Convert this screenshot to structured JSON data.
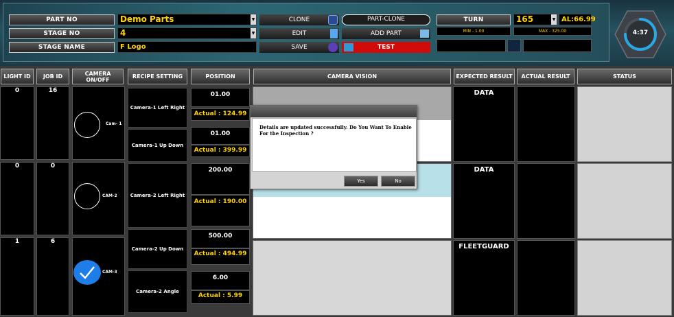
{
  "header": {
    "labels": {
      "part_no": "PART NO",
      "stage_no": "STAGE NO",
      "stage_name": "STAGE NAME"
    },
    "fields": {
      "part_no": "Demo Parts",
      "stage_no": "4",
      "stage_name": "F Logo"
    },
    "buttons": {
      "clone": "CLONE",
      "part_clone": "PART-CLONE",
      "edit": "EDIT",
      "add_part": "ADD PART",
      "save": "SAVE",
      "test": "TEST",
      "turn": "TURN"
    },
    "turn_value": "165",
    "al_value": "AL:66.99",
    "min_label": "MIN - 1.00",
    "max_label": "MAX - 325.00",
    "timer": "4:37",
    "timer_progress": 0.75
  },
  "columns": {
    "light_id": "LIGHT ID",
    "job_id": "JOB ID",
    "camera_on_off": "CAMERA ON/OFF",
    "recipe_setting": "RECIPE SETTING",
    "position": "POSITION",
    "camera_vision": "CAMERA VISION",
    "expected_result": "EXPECTED RESULT",
    "actual_result": "ACTUAL RESULT",
    "status": "STATUS"
  },
  "rows": [
    {
      "light_id": "0",
      "job_id": "16",
      "camera": "Cam- 1",
      "camera_on": false,
      "expected": "DATA"
    },
    {
      "light_id": "0",
      "job_id": "0",
      "camera": "CAM-2",
      "camera_on": false,
      "expected": "DATA"
    },
    {
      "light_id": "1",
      "job_id": "6",
      "camera": "CAM-3",
      "camera_on": true,
      "expected": "FLEETGUARD"
    }
  ],
  "recipes": [
    {
      "name": "Camera-1 Left Right",
      "position": "01.00",
      "actual": "Actual : 124.99"
    },
    {
      "name": "Camera-1 Up Down",
      "position": "01.00",
      "actual": "Actual : 399.99"
    },
    {
      "name": "Camera-2 Left Right",
      "position": "200.00",
      "actual": "Actual : 190.00"
    },
    {
      "name": "Camera-2 Up Down",
      "position": "500.00",
      "actual": "Actual : 494.99"
    },
    {
      "name": "Camera-2 Angle",
      "position": "6.00",
      "actual": "Actual : 5.99"
    }
  ],
  "dialog": {
    "message": "Details are updated successfully. Do You Want To Enable For the Inspection ?",
    "yes": "Yes",
    "no": "No"
  },
  "colors": {
    "accent_yellow": "#ffd400",
    "test_red": "#d10a0a",
    "check_blue": "#1e7de6"
  }
}
